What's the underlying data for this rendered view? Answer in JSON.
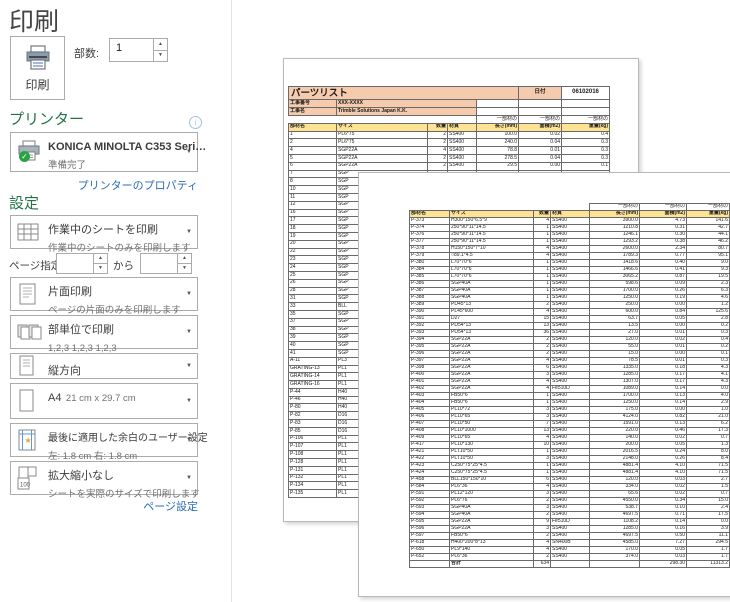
{
  "app": {
    "title": "印刷"
  },
  "toolbar": {
    "print_label": "印刷",
    "copies_label": "部数:",
    "copies_value": "1"
  },
  "printer": {
    "heading": "プリンター",
    "name": "KONICA MINOLTA C353 Seri…",
    "status": "準備完了",
    "properties_link": "プリンターのプロパティ"
  },
  "settings": {
    "heading": "設定",
    "sheet": {
      "title": "作業中のシートを印刷",
      "subtitle": "作業中のシートのみを印刷します"
    },
    "pages": {
      "label": "ページ指定:",
      "to": "から",
      "from_value": "",
      "to_value": ""
    },
    "duplex": {
      "title": "片面印刷",
      "subtitle": "ページの片面のみを印刷します"
    },
    "collate": {
      "title": "部単位で印刷",
      "subtitle": "1,2,3    1,2,3    1,2,3"
    },
    "orientation": {
      "title": "縦方向"
    },
    "paper": {
      "title": "A4",
      "subtitle": "21 cm x 29.7 cm"
    },
    "margins": {
      "title": "最後に適用した余白のユーザー設定",
      "subtitle": "左:  1.8 cm   右:  1.8 cm"
    },
    "scaling": {
      "title": "拡大縮小なし",
      "subtitle": "シートを実際のサイズで印刷します"
    },
    "page_setup_link": "ページ設定"
  },
  "preview": {
    "table_headers": {
      "group_label": "一部材の",
      "columns": [
        "部材名",
        "サイズ",
        "数量",
        "材質",
        "長さ(mm)",
        "面積(m2)",
        "重量(kg)"
      ]
    },
    "page1": {
      "title": "パーツリスト",
      "date_label": "日付",
      "date_value": "06102016",
      "project_no_label": "工事番号",
      "project_no": "XXX-XXXX",
      "project_name_label": "工事名",
      "project_name": "Trimble Solutions Japan K.K.",
      "rows": [
        [
          "1",
          "PL6*75",
          "2",
          "SS400",
          "100.0",
          "0.02",
          "0.4"
        ],
        [
          "2",
          "PL6*75",
          "2",
          "SS400",
          "240.0",
          "0.04",
          "0.3"
        ],
        [
          "4",
          "SGP22A",
          "4",
          "SS400",
          "78.8",
          "0.01",
          "0.3"
        ],
        [
          "5",
          "SGP22A",
          "2",
          "SS400",
          "278.5",
          "0.04",
          "0.3"
        ],
        [
          "6",
          "SGP22A",
          "2",
          "SS400",
          "29.5",
          "0.00",
          "0.1"
        ],
        [
          "7",
          "SGP",
          "",
          "",
          "",
          "",
          ""
        ],
        [
          "8",
          "SGP",
          "",
          "",
          "",
          "",
          ""
        ],
        [
          "10",
          "SGP",
          "",
          "",
          "",
          "",
          ""
        ],
        [
          "11",
          "SGP",
          "",
          "",
          "",
          "",
          ""
        ],
        [
          "12",
          "SGP",
          "",
          "",
          "",
          "",
          ""
        ],
        [
          "16",
          "SGP",
          "",
          "",
          "",
          "",
          ""
        ],
        [
          "17",
          "SGP",
          "",
          "",
          "",
          "",
          ""
        ],
        [
          "18",
          "SGP",
          "",
          "",
          "",
          "",
          ""
        ],
        [
          "19",
          "SGP",
          "",
          "",
          "",
          "",
          ""
        ],
        [
          "20",
          "SGP",
          "",
          "",
          "",
          "",
          ""
        ],
        [
          "22",
          "SGP",
          "",
          "",
          "",
          "",
          ""
        ],
        [
          "23",
          "SGP",
          "",
          "",
          "",
          "",
          ""
        ],
        [
          "24",
          "SGP",
          "",
          "",
          "",
          "",
          ""
        ],
        [
          "25",
          "SGP",
          "",
          "",
          "",
          "",
          ""
        ],
        [
          "26",
          "SGP",
          "",
          "",
          "",
          "",
          ""
        ],
        [
          "28",
          "SGP",
          "",
          "",
          "",
          "",
          ""
        ],
        [
          "31",
          "SGP",
          "",
          "",
          "",
          "",
          ""
        ],
        [
          "33",
          "BLL",
          "",
          "",
          "",
          "",
          ""
        ],
        [
          "35",
          "SGP",
          "",
          "",
          "",
          "",
          ""
        ],
        [
          "37",
          "SGP",
          "",
          "",
          "",
          "",
          ""
        ],
        [
          "38",
          "SGP",
          "",
          "",
          "",
          "",
          ""
        ],
        [
          "39",
          "SGP",
          "",
          "",
          "",
          "",
          ""
        ],
        [
          "40",
          "SGP",
          "",
          "",
          "",
          "",
          ""
        ],
        [
          "41",
          "SGP",
          "",
          "",
          "",
          "",
          ""
        ],
        [
          "A-11",
          "PL3",
          "",
          "",
          "",
          "",
          ""
        ],
        [
          "GRATING-13",
          "PL1",
          "",
          "",
          "",
          "",
          ""
        ],
        [
          "GRATING-14",
          "PL1",
          "",
          "",
          "",
          "",
          ""
        ],
        [
          "GRATING-16",
          "PL1",
          "",
          "",
          "",
          "",
          ""
        ],
        [
          "P-44",
          "H40",
          "",
          "",
          "",
          "",
          ""
        ],
        [
          "P-46",
          "H40",
          "",
          "",
          "",
          "",
          ""
        ],
        [
          "P-80",
          "H40",
          "",
          "",
          "",
          "",
          ""
        ],
        [
          "P-82",
          "D16",
          "",
          "",
          "",
          "",
          ""
        ],
        [
          "P-83",
          "D16",
          "",
          "",
          "",
          "",
          ""
        ],
        [
          "P-85",
          "D16",
          "",
          "",
          "",
          "",
          ""
        ],
        [
          "P-106",
          "PL1",
          "",
          "",
          "",
          "",
          ""
        ],
        [
          "P-107",
          "PL1",
          "",
          "",
          "",
          "",
          ""
        ],
        [
          "P-108",
          "PL1",
          "",
          "",
          "",
          "",
          ""
        ],
        [
          "P-128",
          "PL1",
          "",
          "",
          "",
          "",
          ""
        ],
        [
          "P-131",
          "PL1",
          "",
          "",
          "",
          "",
          ""
        ],
        [
          "P-132",
          "PL1",
          "",
          "",
          "",
          "",
          ""
        ],
        [
          "P-134",
          "PL1",
          "",
          "",
          "",
          "",
          ""
        ],
        [
          "P-135",
          "PL1",
          "",
          "",
          "",
          "",
          ""
        ]
      ]
    },
    "page2": {
      "rows": [
        [
          "P-373",
          "H300*150*6.5*9",
          "4",
          "SS400",
          "3900.0",
          "4.73",
          "141.6"
        ],
        [
          "P-374",
          "250*90*11*14.5",
          "1",
          "SS400",
          "1210.8",
          "0.31",
          "42.7"
        ],
        [
          "P-376",
          "250*90*11*14.5",
          "1",
          "SS400",
          "1246.1",
          "0.30",
          "44.1"
        ],
        [
          "P-377",
          "250*90*11*14.5",
          "1",
          "SS400",
          "1293.2",
          "0.38",
          "46.2"
        ],
        [
          "P-378",
          "H150*150*7*10",
          "4",
          "SS400",
          "2600.0",
          "2.34",
          "80.7"
        ],
        [
          "P-379",
          "○89.1*4.5",
          "4",
          "SS400",
          "1789.3",
          "0.77",
          "95.1"
        ],
        [
          "P-380",
          "L70*70*6",
          "1",
          "SS400",
          "1418.6",
          "0.40",
          "9.0"
        ],
        [
          "P-384",
          "L70*70*6",
          "1",
          "SS400",
          "1466.6",
          "0.41",
          "9.3"
        ],
        [
          "P-385",
          "L70*70*6",
          "1",
          "SS400",
          "3065.2",
          "0.87",
          "19.5"
        ],
        [
          "P-386",
          "SGP40A",
          "1",
          "SS400",
          "598.6",
          "0.09",
          "2.3"
        ],
        [
          "P-387",
          "SGP40A",
          "1",
          "SS400",
          "1700.0",
          "0.26",
          "6.3"
        ],
        [
          "P-388",
          "SGP40A",
          "1",
          "SS400",
          "1250.0",
          "0.19",
          "4.6"
        ],
        [
          "P-389",
          "PD45*13",
          "2",
          "SS400",
          "250.0",
          "0.00",
          "1.2"
        ],
        [
          "P-390",
          "PL45*600",
          "4",
          "SS400",
          "600.0",
          "0.84",
          "125.6"
        ],
        [
          "P-391",
          "D27",
          "15",
          "SS400",
          "63.7",
          "0.05",
          "2.8"
        ],
        [
          "P-392",
          "PD54*13",
          "13",
          "SS400",
          "13.5",
          "0.00",
          "0.2"
        ],
        [
          "P-393",
          "PD54*13",
          "36",
          "SS400",
          "27.0",
          "0.01",
          "0.3"
        ],
        [
          "P-394",
          "SGP22A",
          "2",
          "SS400",
          "120.0",
          "0.02",
          "0.4"
        ],
        [
          "P-395",
          "SGP22A",
          "2",
          "SS400",
          "55.0",
          "0.01",
          "0.2"
        ],
        [
          "P-396",
          "SGP22A",
          "2",
          "SS400",
          "15.0",
          "0.00",
          "0.1"
        ],
        [
          "P-397",
          "SGP22A",
          "4",
          "SS400",
          "78.5",
          "0.01",
          "0.3"
        ],
        [
          "P-398",
          "SGP22A",
          "6",
          "SS400",
          "1335.0",
          "0.18",
          "4.3"
        ],
        [
          "P-400",
          "SGP22A",
          "3",
          "SS400",
          "1285.0",
          "0.17",
          "4.1"
        ],
        [
          "P-401",
          "SGP22A",
          "4",
          "SS400",
          "1307.0",
          "0.17",
          "4.3"
        ],
        [
          "P-402",
          "SGP22A",
          "4",
          "Fe510D",
          "1089.0",
          "0.14",
          "0.0"
        ],
        [
          "P-403",
          "FB50*6",
          "1",
          "SS400",
          "1700.0",
          "0.13",
          "4.0"
        ],
        [
          "P-404",
          "FB50*6",
          "1",
          "SS400",
          "1250.0",
          "0.14",
          "2.9"
        ],
        [
          "P-405",
          "PL10*72",
          "3",
          "SS400",
          "175.0",
          "0.00",
          "1.0"
        ],
        [
          "P-406",
          "PL10*65",
          "3",
          "SS400",
          "4124.0",
          "0.82",
          "21.0"
        ],
        [
          "P-407",
          "PL10*50",
          "7",
          "SS400",
          "1591.0",
          "0.13",
          "6.2"
        ],
        [
          "P-408",
          "PL10*1000",
          "13",
          "SS400",
          "220.0",
          "0.46",
          "17.3"
        ],
        [
          "P-409",
          "PL10*65",
          "4",
          "SS400",
          "140.0",
          "0.02",
          "0.7"
        ],
        [
          "P-417",
          "PL10*130",
          "10",
          "SS400",
          "200.0",
          "0.05",
          "1.3"
        ],
        [
          "P-421",
          "PLT10*50",
          "1",
          "SS400",
          "2016.5",
          "0.24",
          "8.0"
        ],
        [
          "P-422",
          "PLT10*50",
          "3",
          "SS400",
          "2148.0",
          "0.26",
          "8.4"
        ],
        [
          "P-423",
          "C250*75*25*4.5",
          "1",
          "SS400",
          "4881.4",
          "4.10",
          "71.5"
        ],
        [
          "P-424",
          "C250*75*25*4.5",
          "1",
          "SS400",
          "4881.4",
          "4.10",
          "71.5"
        ],
        [
          "P-458",
          "BLL150*150*10",
          "6",
          "SS400",
          "120.0",
          "0.03",
          "2.7"
        ],
        [
          "P-584",
          "PL6*36",
          "4",
          "SS400",
          "334.0",
          "0.02",
          "1.5"
        ],
        [
          "P-591",
          "PL12*120",
          "3",
          "SS400",
          "65.6",
          "0.02",
          "0.7"
        ],
        [
          "P-592",
          "PL6*76",
          "2",
          "SS400",
          "4550.0",
          "0.34",
          "15.0"
        ],
        [
          "P-593",
          "SGP40A",
          "3",
          "SS400",
          "538.7",
          "0.10",
          "2.4"
        ],
        [
          "P-594",
          "SGP40A",
          "2",
          "SS400",
          "4697.5",
          "0.71",
          "17.5"
        ],
        [
          "P-595",
          "SGP22A",
          "9",
          "Fe510D",
          "1108.2",
          "0.14",
          "0.0"
        ],
        [
          "P-596",
          "SGP22A",
          "3",
          "SS400",
          "1285.0",
          "0.16",
          "3.9"
        ],
        [
          "P-597",
          "FB50*6",
          "2",
          "SS400",
          "4697.5",
          "0.50",
          "11.1"
        ],
        [
          "P-618",
          "H400*200*8*13",
          "4",
          "SN400B",
          "4585.0",
          "7.27",
          "294.5"
        ],
        [
          "P-650",
          "PL9*140",
          "4",
          "SS400",
          "170.0",
          "0.05",
          "1.7"
        ],
        [
          "P-652",
          "PL6*36",
          "2",
          "SS400",
          "374.0",
          "0.03",
          "1.7"
        ]
      ],
      "total_row": [
        "",
        "合計",
        "634",
        "",
        "",
        "298.30",
        "11313.2"
      ]
    }
  }
}
